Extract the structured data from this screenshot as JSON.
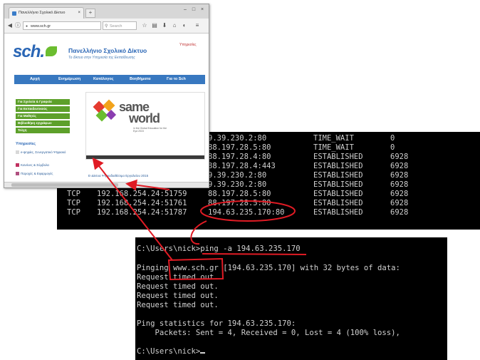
{
  "browser": {
    "tab_title": "Πανελλήνιο Σχολικό Δίκτυο",
    "tab_close": "×",
    "new_tab": "+",
    "url": "www.sch.gr",
    "search_placeholder": "Search",
    "page": {
      "logo_text": "sch.",
      "site_title": "Πανελλήνιο Σχολικό Δίκτυο",
      "site_subtitle": "Το δίκτυο στην Υπηρεσία της Εκπαίδευσης",
      "top_link": "Υπηρεσίες",
      "menu": [
        "Αρχή",
        "Ενημέρωση",
        "Κατάλογος",
        "Βοηθήματα",
        "Για το Sch"
      ],
      "sidebar_buttons": [
        "Για Σχολεία & Γραφεία",
        "Για Εκπαιδευτικούς",
        "Για Μαθητές",
        "Βιβλιοθήκη εγγράφων",
        "Τεύχη"
      ],
      "sidebar_heading": "Υπηρεσίες",
      "sidebar_links": [
        "e-ψηφίες, Συνεργατικό Ψηφιακό",
        "Κανόνες & Σύμβολα",
        "Παροχές & Εφαρμογές"
      ],
      "banner_word1": "same",
      "banner_word2": "world",
      "banner_tagline": "in the Global Education for the Eyd 2015",
      "news_link": "Ε-Δίκτυα Ψηφιοδιαθέσιμο Εργαλείου 2015"
    }
  },
  "netstat": {
    "rows": [
      {
        "proto": "",
        "local": "",
        "foreign": "9.39.230.2:80",
        "state": "TIME_WAIT",
        "pid": "0"
      },
      {
        "proto": "",
        "local": "",
        "foreign": "88.197.28.5:80",
        "state": "TIME_WAIT",
        "pid": "0"
      },
      {
        "proto": "",
        "local": "",
        "foreign": "88.197.28.4:80",
        "state": "ESTABLISHED",
        "pid": "6928"
      },
      {
        "proto": "",
        "local": "",
        "foreign": "88.197.28.4:443",
        "state": "ESTABLISHED",
        "pid": "6928"
      },
      {
        "proto": "",
        "local": "",
        "foreign": "9.39.230.2:80",
        "state": "ESTABLISHED",
        "pid": "6928"
      },
      {
        "proto": "",
        "local": "",
        "foreign": "9.39.230.2:80",
        "state": "ESTABLISHED",
        "pid": "6928"
      },
      {
        "proto": "TCP",
        "local": "192.168.254.24:51759",
        "foreign": "88.197.28.5:80",
        "state": "ESTABLISHED",
        "pid": "6928"
      },
      {
        "proto": "TCP",
        "local": "192.168.254.24:51761",
        "foreign": "88.197.28.5:80",
        "state": "ESTABLISHED",
        "pid": "6928"
      },
      {
        "proto": "TCP",
        "local": "192.168.254.24:51787",
        "foreign": "194.63.235.170:80",
        "state": "ESTABLISHED",
        "pid": "6928"
      }
    ]
  },
  "ping": {
    "prompt_line": "C:\\Users\\nick>ping -a 194.63.235.170",
    "pinging_prefix": "Pinging ",
    "pinging_host": "www.sch.gr",
    "pinging_suffix": " [194.63.235.170] with 32 bytes of data:",
    "timeout_lines": [
      "Request timed out.",
      "Request timed out.",
      "Request timed out.",
      "Request timed out."
    ],
    "stats_header": "Ping statistics for 194.63.235.170:",
    "stats_line": "    Packets: Sent = 4, Received = 0, Lost = 4 (100% loss),",
    "final_prompt": "C:\\Users\\nick>"
  },
  "colors": {
    "annotation": "#e01b24",
    "sch_blue": "#2a66b5",
    "sch_green": "#5da02a"
  }
}
